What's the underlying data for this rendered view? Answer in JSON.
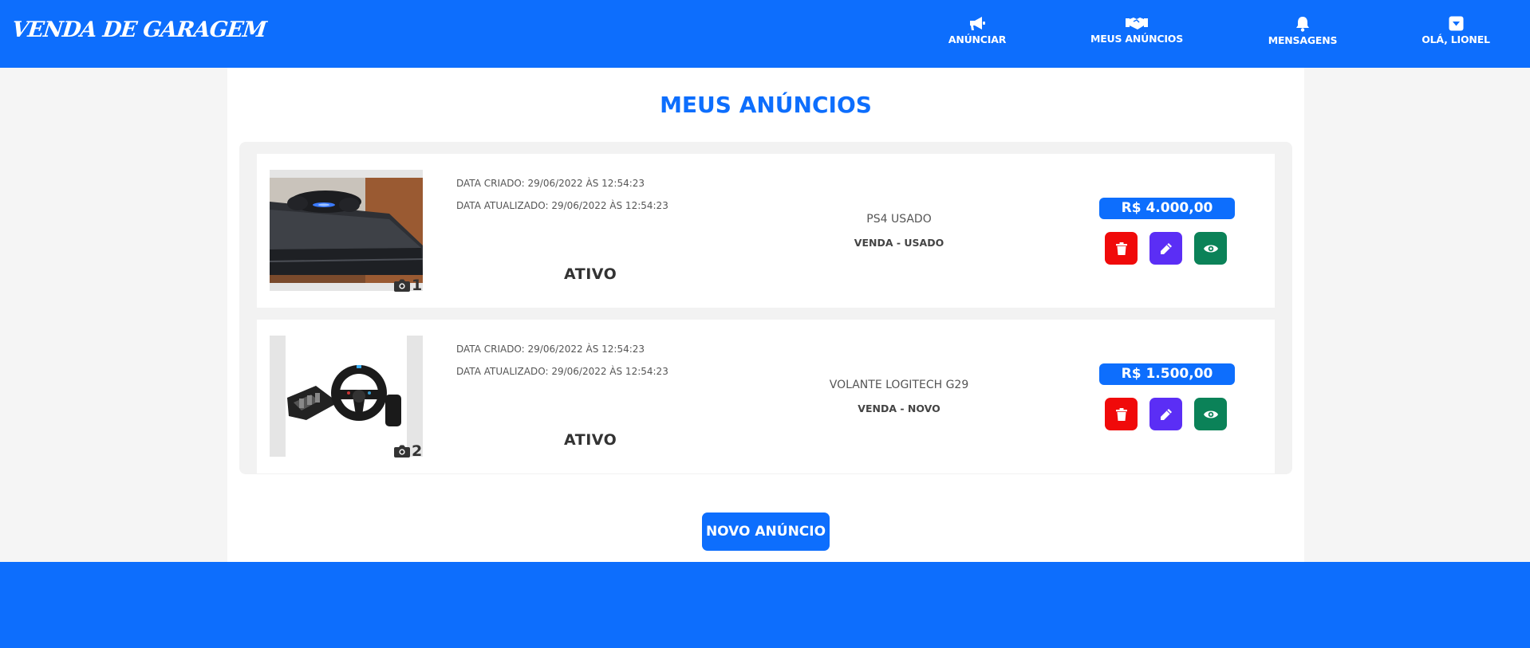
{
  "header": {
    "brand": "VENDA DE GARAGEM",
    "nav": [
      {
        "label": "ANÚNCIAR",
        "icon": "megaphone-icon"
      },
      {
        "label": "MEUS ANÚNCIOS",
        "icon": "handshake-icon"
      },
      {
        "label": "MENSAGENS",
        "icon": "bell-icon"
      },
      {
        "label": "OLÁ, LIONEL",
        "icon": "caret-square-down-icon"
      }
    ]
  },
  "page": {
    "title": "MEUS ANÚNCIOS",
    "new_button": "NOVO ANÚNCIO"
  },
  "listings": [
    {
      "photo_count": "1",
      "created": "DATA CRIADO: 29/06/2022 ÀS 12:54:23",
      "updated": "DATA ATUALIZADO: 29/06/2022 ÀS 12:54:23",
      "status": "ATIVO",
      "title": "PS4 USADO",
      "type": "VENDA - USADO",
      "price": "R$ 4.000,00"
    },
    {
      "photo_count": "2",
      "created": "DATA CRIADO: 29/06/2022 ÀS 12:54:23",
      "updated": "DATA ATUALIZADO: 29/06/2022 ÀS 12:54:23",
      "status": "ATIVO",
      "title": "VOLANTE LOGITECH G29",
      "type": "VENDA - NOVO",
      "price": "R$ 1.500,00"
    }
  ],
  "colors": {
    "primary": "#0d6efd",
    "delete": "#f00a0a",
    "edit": "#5b2ef5",
    "view": "#0b8258"
  }
}
